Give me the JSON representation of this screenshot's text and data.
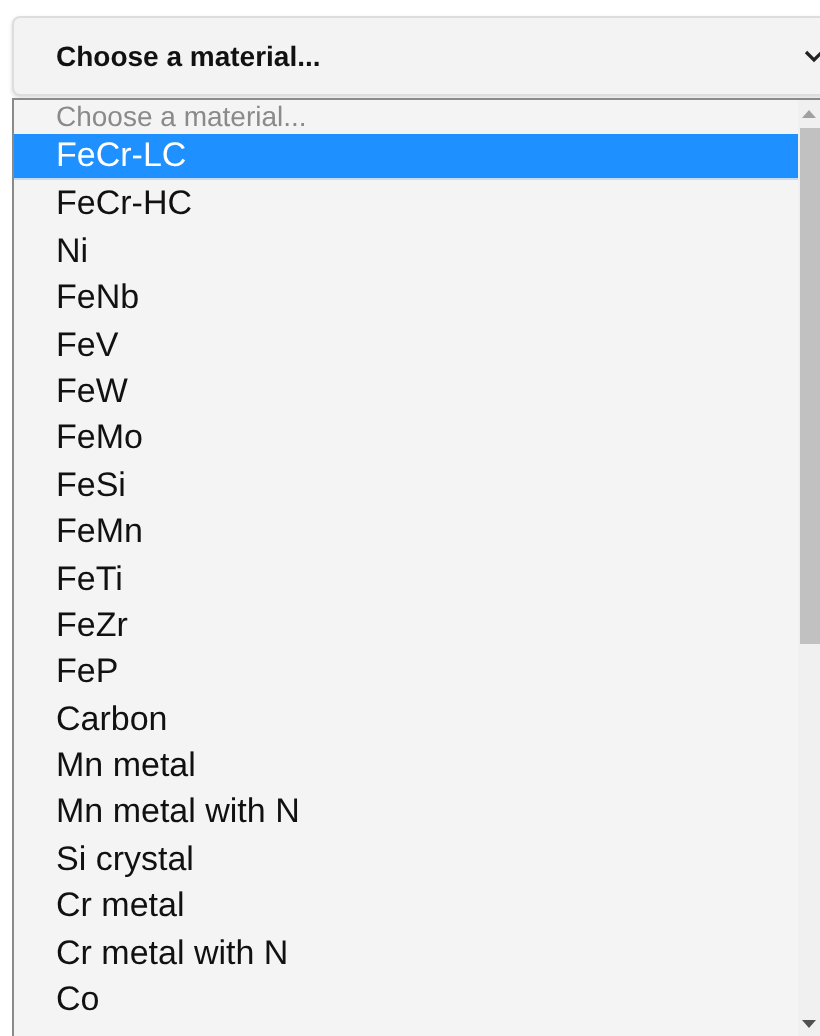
{
  "select": {
    "value": "Choose a material..."
  },
  "dropdown": {
    "placeholder": "Choose a material...",
    "options": [
      {
        "label": "FeCr-LC",
        "selected": true
      },
      {
        "label": "FeCr-HC",
        "selected": false
      },
      {
        "label": "Ni",
        "selected": false
      },
      {
        "label": "FeNb",
        "selected": false
      },
      {
        "label": "FeV",
        "selected": false
      },
      {
        "label": "FeW",
        "selected": false
      },
      {
        "label": "FeMo",
        "selected": false
      },
      {
        "label": "FeSi",
        "selected": false
      },
      {
        "label": "FeMn",
        "selected": false
      },
      {
        "label": "FeTi",
        "selected": false
      },
      {
        "label": "FeZr",
        "selected": false
      },
      {
        "label": "FeP",
        "selected": false
      },
      {
        "label": "Carbon",
        "selected": false
      },
      {
        "label": "Mn metal",
        "selected": false
      },
      {
        "label": "Mn metal with N",
        "selected": false
      },
      {
        "label": "Si crystal",
        "selected": false
      },
      {
        "label": "Cr metal",
        "selected": false
      },
      {
        "label": "Cr metal with N",
        "selected": false
      },
      {
        "label": "Co",
        "selected": false
      }
    ]
  }
}
